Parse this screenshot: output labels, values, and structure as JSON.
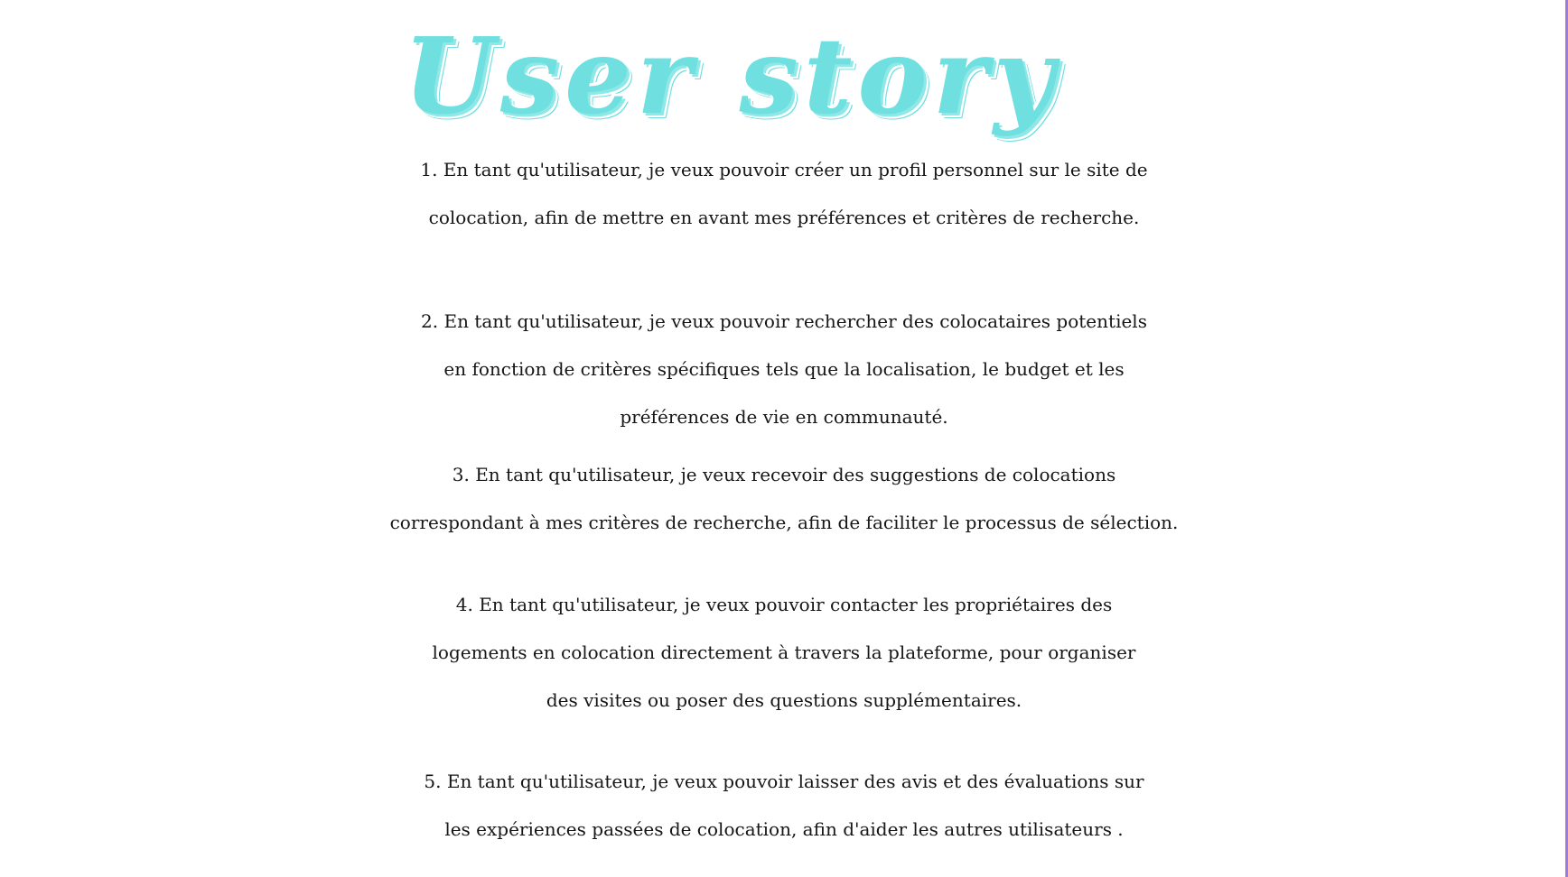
{
  "title": "User story",
  "stories": [
    {
      "lines": [
        "1. En tant qu'utilisateur, je veux pouvoir créer un profil personnel sur le site de",
        "colocation, afin de mettre en avant mes préférences et critères de recherche."
      ]
    },
    {
      "lines": [
        "2. En tant qu'utilisateur, je veux pouvoir rechercher des colocataires potentiels",
        "en fonction de critères spécifiques tels que la localisation, le budget et les",
        "préférences de vie en communauté."
      ]
    },
    {
      "lines": [
        "3. En tant qu'utilisateur, je veux recevoir des suggestions de colocations",
        "correspondant à mes critères de recherche, afin de faciliter le processus de sélection."
      ]
    },
    {
      "lines": [
        "4. En tant qu'utilisateur, je veux pouvoir contacter les propriétaires des",
        "logements en colocation directement à travers la plateforme, pour organiser",
        "des visites ou poser des questions supplémentaires."
      ]
    },
    {
      "lines": [
        "5. En tant qu'utilisateur, je veux pouvoir laisser des avis et des évaluations sur",
        "les expériences passées de colocation, afin d'aider les autres utilisateurs ."
      ]
    }
  ]
}
